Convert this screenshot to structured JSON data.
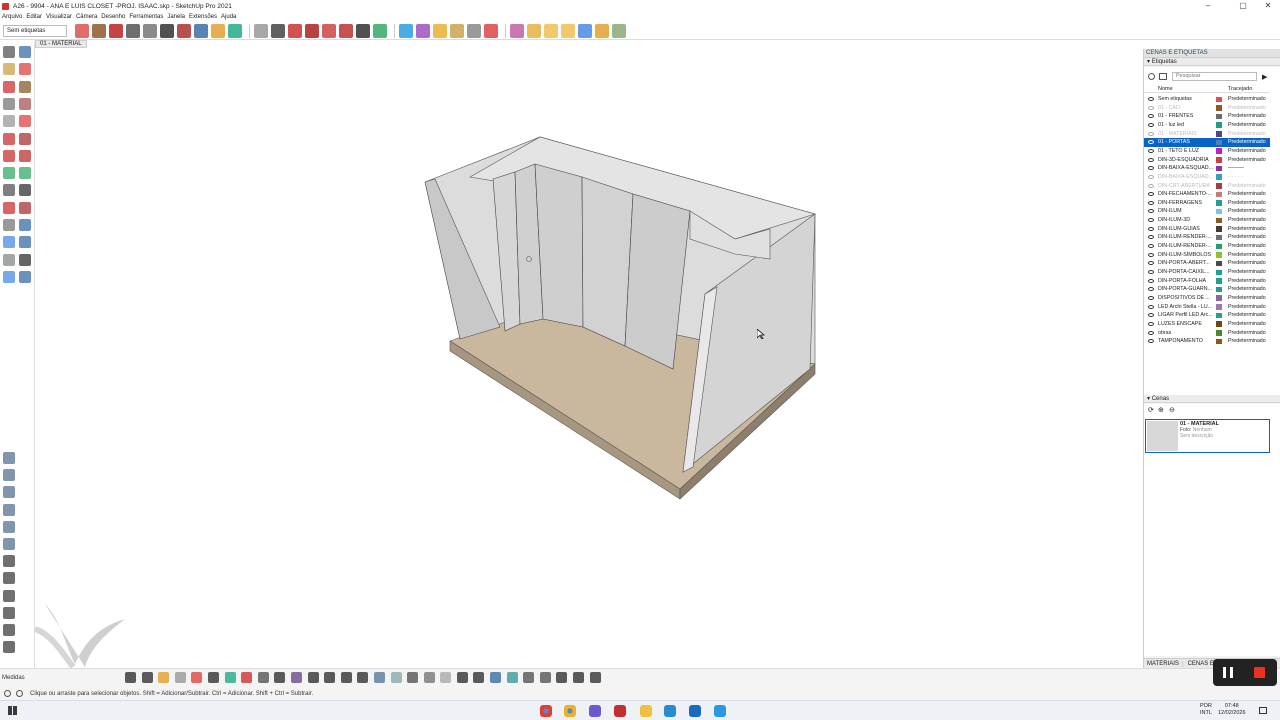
{
  "window": {
    "title": "A26 - 9904 - ANA E LUIS CLOSET -PROJ. ISAAC.skp - SketchUp Pro 2021",
    "controls": [
      "–",
      "▢",
      "✕"
    ]
  },
  "menu": [
    "Arquivo",
    "Editar",
    "Visualizar",
    "Câmera",
    "Desenho",
    "Ferramentas",
    "Janela",
    "Extensões",
    "Ajuda"
  ],
  "toolbar": {
    "tag_selector": "Sem etiquetas",
    "icon_colors": [
      "#d9534f",
      "#8b5a2b",
      "#b22",
      "#555",
      "#777",
      "#333",
      "#a33",
      "#3a6ea5",
      "#e0a030",
      "#2a8",
      "#999",
      "#444",
      "#c33",
      "#a22",
      "#c44",
      "#b33",
      "#333",
      "#3a6",
      "#2a9de0",
      "#a050c0",
      "#e8b030",
      "#c9a34a",
      "#888",
      "#d44",
      "#c060a0",
      "#e8b040",
      "#f0c050",
      "#f0c050",
      "#4a8be0",
      "#e0a030",
      "#8a7"
    ]
  },
  "scene_tab": "01 - MATERIAL",
  "tray": {
    "header": "CENAS E ETIQUETAS",
    "tags_panel": {
      "title": "Etiquetas",
      "search_placeholder": "Pesquisar",
      "col_name": "Nome",
      "col_dash": "Tracejado",
      "rows": [
        {
          "name": "Sem etiquetas",
          "color": "#e05050",
          "dash": "Predeterminado",
          "state": "normal"
        },
        {
          "name": "01 - CAD",
          "color": "#8a5a2a",
          "dash": "Predeterminado",
          "state": "hidden"
        },
        {
          "name": "01 - FRENTES",
          "color": "#6a6a6a",
          "dash": "Predeterminado",
          "state": "normal"
        },
        {
          "name": "01 - luz led",
          "color": "#20a080",
          "dash": "Predeterminado",
          "state": "normal"
        },
        {
          "name": "01 - MATERIAIS",
          "color": "#4a4a8a",
          "dash": "Predeterminado",
          "state": "hidden"
        },
        {
          "name": "01 - PORTAS",
          "color": "#5080c0",
          "dash": "Predeterminado",
          "state": "selected"
        },
        {
          "name": "01 - TETO E LUZ",
          "color": "#c020c0",
          "dash": "Predeterminado",
          "state": "normal"
        },
        {
          "name": "DIN-3D-ESQUADRIA",
          "color": "#d04040",
          "dash": "Predeterminado",
          "state": "normal"
        },
        {
          "name": "DIN-BAIXA-ESQUAD...",
          "color": "#9030a0",
          "dash": "———",
          "state": "normal"
        },
        {
          "name": "DIN-BAIXA-ESQUAD...",
          "color": "#30a0c0",
          "dash": "- - - - -",
          "state": "hidden"
        },
        {
          "name": "DIN-CRT-ABERTURA",
          "color": "#a04040",
          "dash": "Predeterminado",
          "state": "hidden"
        },
        {
          "name": "DIN-FECHAMENTO-...",
          "color": "#c08080",
          "dash": "Predeterminado",
          "state": "normal"
        },
        {
          "name": "DIN-FERRAGENS",
          "color": "#20a090",
          "dash": "Predeterminado",
          "state": "normal"
        },
        {
          "name": "DIN-ILUM",
          "color": "#80c0f0",
          "dash": "Predeterminado",
          "state": "normal"
        },
        {
          "name": "DIN-ILUM-3D",
          "color": "#8a5a2a",
          "dash": "Predeterminado",
          "state": "normal"
        },
        {
          "name": "DIN-ILUM-GUIAS",
          "color": "#4a3a2a",
          "dash": "Predeterminado",
          "state": "normal"
        },
        {
          "name": "DIN-ILUM-RENDER-...",
          "color": "#707070",
          "dash": "Predeterminado",
          "state": "normal"
        },
        {
          "name": "DIN-ILUM-RENDER-...",
          "color": "#20a070",
          "dash": "Predeterminado",
          "state": "normal"
        },
        {
          "name": "DIN-ILUM-SÍMBOLOS",
          "color": "#90c030",
          "dash": "Predeterminado",
          "state": "normal"
        },
        {
          "name": "DIN-PORTA-ABERT...",
          "color": "#4a4a4a",
          "dash": "Predeterminado",
          "state": "normal"
        },
        {
          "name": "DIN-PORTA-CAIXIL...",
          "color": "#20a090",
          "dash": "Predeterminado",
          "state": "normal"
        },
        {
          "name": "DIN-PORTA-FOLHA",
          "color": "#20a090",
          "dash": "Predeterminado",
          "state": "normal"
        },
        {
          "name": "DIN-PORTA-GUARN...",
          "color": "#20a090",
          "dash": "Predeterminado",
          "state": "normal"
        },
        {
          "name": "DISPOSITIVOS DE ...",
          "color": "#8a6a9a",
          "dash": "Predeterminado",
          "state": "normal"
        },
        {
          "name": "LED Archi Stella - LU...",
          "color": "#9a7ab0",
          "dash": "Predeterminado",
          "state": "normal"
        },
        {
          "name": "LIGAR Perfil LED Arc...",
          "color": "#20a090",
          "dash": "Predeterminado",
          "state": "normal"
        },
        {
          "name": "LUZES ENSCAPE",
          "color": "#6a4a1a",
          "dash": "Predeterminado",
          "state": "normal"
        },
        {
          "name": "obras",
          "color": "#4a8a2a",
          "dash": "Predeterminado",
          "state": "normal"
        },
        {
          "name": "TAMPONAMENTO",
          "color": "#8a5a1a",
          "dash": "Predeterminado",
          "state": "normal"
        }
      ]
    },
    "scenes_panel": {
      "title": "Cenas",
      "scene_name": "01 - MATERIAL",
      "scene_photo_label": "Foto:",
      "scene_photo_value": "Nenhum",
      "scene_desc": "Sem descrição"
    },
    "bottom_tabs": [
      "MATERIAIS",
      "CENAS E ETI"
    ]
  },
  "statusbar": {
    "measure_label": "Medidas",
    "message": "Clique ou arraste para selecionar objetos. Shift = Adicionar/Subtrair. Ctrl = Adicionar. Shift + Ctrl = Subtrair."
  },
  "taskbar": {
    "lang_top": "POR",
    "lang_bottom": "INTL",
    "time": "07:48",
    "date": "12/02/2026"
  },
  "colors": {
    "selection": "#0a64c8",
    "floor": "#cbb9a0",
    "wall": "#d9d9d9",
    "rec_stop": "#e8321e"
  }
}
